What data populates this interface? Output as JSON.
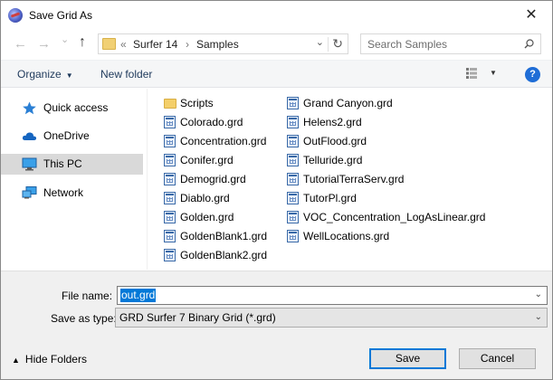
{
  "window": {
    "title": "Save Grid As",
    "close_glyph": "✕"
  },
  "navbar": {
    "back_glyph": "←",
    "forward_glyph": "→",
    "recent_glyph": "⌄",
    "up_glyph": "↑",
    "breadcrumb_prefix": "«",
    "breadcrumb": [
      "Surfer 14",
      "Samples"
    ],
    "breadcrumb_sep": "›",
    "address_dropdown_glyph": "⌄",
    "refresh_glyph": "↻",
    "search_placeholder": "Search Samples"
  },
  "toolbar": {
    "organize_label": "Organize",
    "new_folder_label": "New folder",
    "help_label": "?"
  },
  "sidebar": {
    "items": [
      {
        "label": "Quick access",
        "icon": "star-icon"
      },
      {
        "label": "OneDrive",
        "icon": "cloud-icon"
      },
      {
        "label": "This PC",
        "icon": "monitor-icon",
        "selected": true
      },
      {
        "label": "Network",
        "icon": "network-icon"
      }
    ]
  },
  "files": {
    "column1": [
      {
        "name": "Scripts",
        "type": "folder"
      },
      {
        "name": "Colorado.grd",
        "type": "grid"
      },
      {
        "name": "Concentration.grd",
        "type": "grid"
      },
      {
        "name": "Conifer.grd",
        "type": "grid"
      },
      {
        "name": "Demogrid.grd",
        "type": "grid"
      },
      {
        "name": "Diablo.grd",
        "type": "grid"
      },
      {
        "name": "Golden.grd",
        "type": "grid"
      },
      {
        "name": "GoldenBlank1.grd",
        "type": "grid"
      },
      {
        "name": "GoldenBlank2.grd",
        "type": "grid"
      }
    ],
    "column2": [
      {
        "name": "Grand Canyon.grd",
        "type": "grid"
      },
      {
        "name": "Helens2.grd",
        "type": "grid"
      },
      {
        "name": "OutFlood.grd",
        "type": "grid"
      },
      {
        "name": "Telluride.grd",
        "type": "grid"
      },
      {
        "name": "TutorialTerraServ.grd",
        "type": "grid"
      },
      {
        "name": "TutorPl.grd",
        "type": "grid"
      },
      {
        "name": "VOC_Concentration_LogAsLinear.grd",
        "type": "grid"
      },
      {
        "name": "WellLocations.grd",
        "type": "grid"
      }
    ]
  },
  "form": {
    "file_name_label": "File name:",
    "file_name_value": "out.grd",
    "save_as_type_label": "Save as type:",
    "save_as_type_value": "GRD Surfer 7 Binary Grid (*.grd)",
    "combo_arrow_glyph": "⌄"
  },
  "footer": {
    "hide_folders_label": "Hide Folders",
    "hide_folders_glyph": "▲",
    "save_label": "Save",
    "cancel_label": "Cancel"
  }
}
